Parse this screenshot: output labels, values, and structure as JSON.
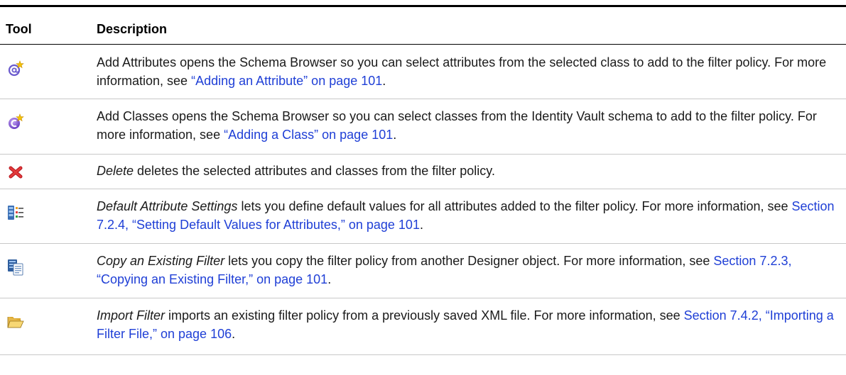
{
  "header": {
    "tool": "Tool",
    "description": "Description"
  },
  "rows": [
    {
      "icon": "add-attribute-icon",
      "name": "",
      "text": "Add Attributes opens the Schema Browser so you can select attributes from the selected class to add to the filter policy. For more information, see ",
      "link": "“Adding an Attribute” on page 101",
      "after": "."
    },
    {
      "icon": "add-class-icon",
      "name": "",
      "text": "Add Classes opens the Schema Browser so you can select classes from the Identity Vault schema to add to the filter policy. For more information, see ",
      "link": "“Adding a Class” on page 101",
      "after": "."
    },
    {
      "icon": "delete-icon",
      "name": "Delete",
      "text": " deletes the selected attributes and classes from the filter policy.",
      "link": "",
      "after": ""
    },
    {
      "icon": "default-attribute-settings-icon",
      "name": "Default Attribute Settings",
      "text": " lets you define default values for all attributes added to the filter policy. For more information, see ",
      "link": "Section 7.2.4, “Setting Default Values for Attributes,” on page 101",
      "after": "."
    },
    {
      "icon": "copy-filter-icon",
      "name": "Copy an Existing Filter",
      "text": " lets you copy the filter policy from another Designer object. For more information, see ",
      "link": "Section 7.2.3, “Copying an Existing Filter,” on page 101",
      "after": "."
    },
    {
      "icon": "import-filter-folder-icon",
      "name": "Import Filter",
      "text": " imports an existing filter policy from a previously saved XML file. For more information, see ",
      "link": "Section 7.4.2, “Importing a Filter File,” on page 106",
      "after": "."
    }
  ]
}
